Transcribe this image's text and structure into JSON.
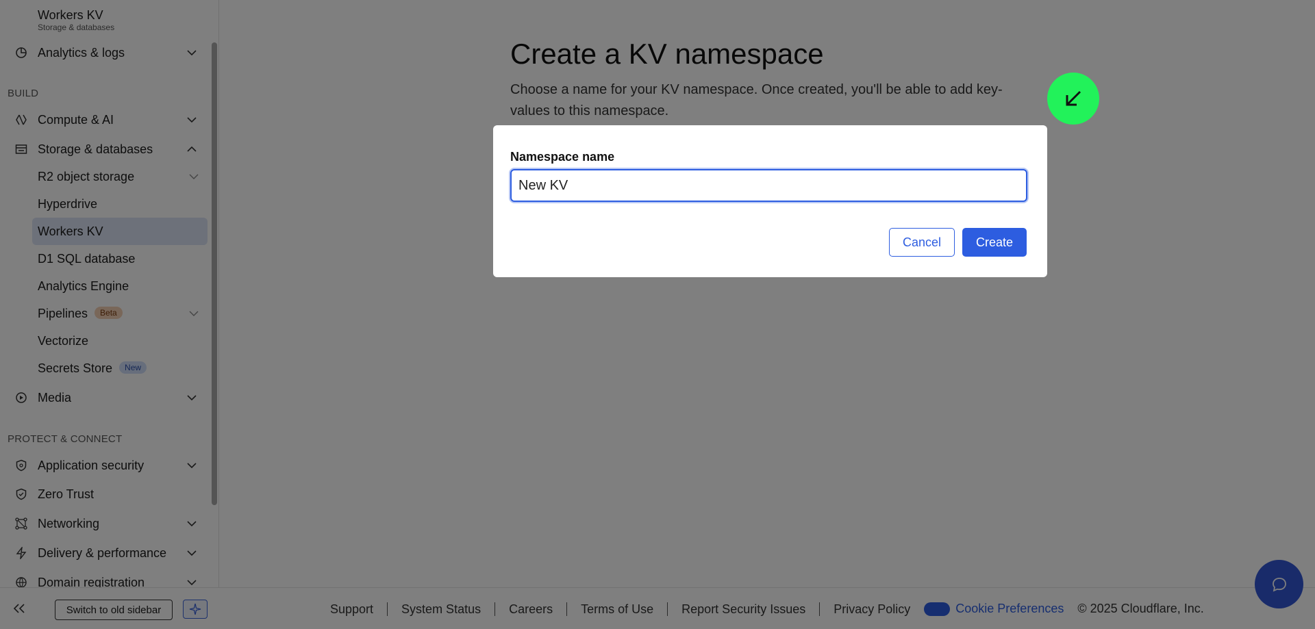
{
  "sidebar": {
    "top_item": {
      "title": "Workers KV",
      "subtitle": "Storage & databases"
    },
    "analytics": {
      "label": "Analytics & logs"
    },
    "build_label": "BUILD",
    "compute": {
      "label": "Compute & AI"
    },
    "storage": {
      "label": "Storage & databases"
    },
    "storage_sub": [
      {
        "label": "R2 object storage"
      },
      {
        "label": "Hyperdrive"
      },
      {
        "label": "Workers KV"
      },
      {
        "label": "D1 SQL database"
      },
      {
        "label": "Analytics Engine"
      },
      {
        "label": "Pipelines",
        "badge": "Beta"
      },
      {
        "label": "Vectorize"
      },
      {
        "label": "Secrets Store",
        "badge": "New"
      }
    ],
    "media": {
      "label": "Media"
    },
    "protect_label": "PROTECT & CONNECT",
    "app_security": {
      "label": "Application security"
    },
    "zero_trust": {
      "label": "Zero Trust"
    },
    "networking": {
      "label": "Networking"
    },
    "delivery": {
      "label": "Delivery & performance"
    },
    "domain_reg": {
      "label": "Domain registration"
    },
    "bottom": {
      "switch_label": "Switch to old sidebar"
    }
  },
  "main": {
    "title": "Create a KV namespace",
    "description": "Choose a name for your KV namespace. Once created, you'll be able to add key-values to this namespace."
  },
  "modal": {
    "field_label": "Namespace name",
    "field_value": "New KV",
    "cancel_label": "Cancel",
    "create_label": "Create"
  },
  "footer": {
    "links": [
      "Support",
      "System Status",
      "Careers",
      "Terms of Use",
      "Report Security Issues",
      "Privacy Policy"
    ],
    "cookie_label": "Cookie Preferences",
    "copyright": "© 2025 Cloudflare, Inc."
  },
  "colors": {
    "accent": "#2d5de0",
    "active_item_bg": "#dbe3f5",
    "cursor_indicator": "#22f25a"
  }
}
